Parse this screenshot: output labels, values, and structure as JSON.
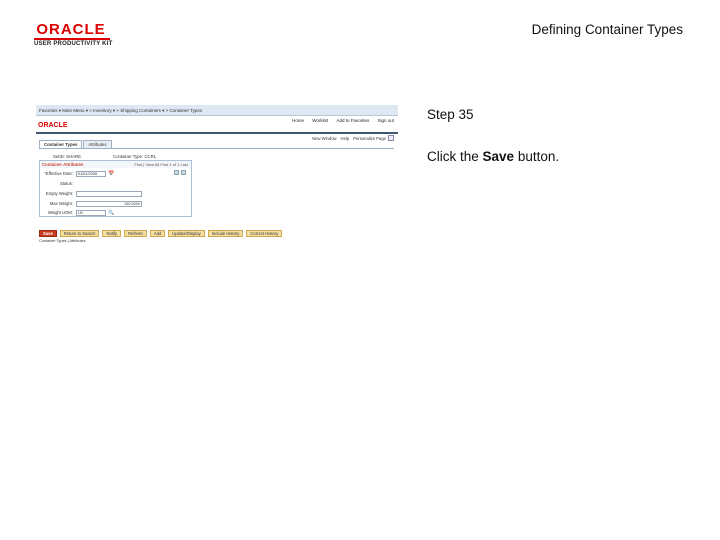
{
  "header": {
    "brand": "ORACLE",
    "product": "USER PRODUCTIVITY KIT",
    "slide_title": "Defining Container Types"
  },
  "step": {
    "label": "Step 35",
    "instruction_prefix": "Click the ",
    "instruction_target": "Save",
    "instruction_suffix": " button."
  },
  "app": {
    "breadcrumb": "Favorites ▾   Main Menu ▾  >  Inventory ▾  >  Shipping Containers ▾  >  Container Types",
    "top_nav": [
      "Home",
      "Worklist",
      "Add to Favorites",
      "Sign out"
    ],
    "logo": "ORACLE",
    "actions": [
      "New Window",
      "Help",
      "Personalize Page"
    ],
    "tabs": [
      {
        "label": "Container Types",
        "active": true
      },
      {
        "label": "Attributes",
        "active": false
      }
    ],
    "setid_label": "SetID: SHARE",
    "container_type_label": "Container Type: CCRL",
    "panel_title": "Container Attributes",
    "panel_nav": "Find | View All   First  1 of 1  Last",
    "fields": [
      {
        "label": "*Effective Date:",
        "value": "01/01/2008",
        "lookup": "📅"
      },
      {
        "label": "Status:",
        "value": "",
        "lookup": ""
      },
      {
        "label": "Empty Weight:",
        "value": "",
        "lookup": ""
      },
      {
        "label": "Max Weight:",
        "value": "150.0000",
        "lookup": ""
      },
      {
        "label": "Weight UOM:",
        "value": "LB",
        "lookup": "🔍"
      }
    ],
    "buttons": [
      {
        "label": "Save",
        "primary": true
      },
      {
        "label": "Return to Search",
        "primary": false
      },
      {
        "label": "Notify",
        "primary": false
      },
      {
        "label": "Refresh",
        "primary": false
      },
      {
        "label": "Add",
        "primary": false
      },
      {
        "label": "Update/Display",
        "primary": false
      },
      {
        "label": "Include History",
        "primary": false
      },
      {
        "label": "Correct History",
        "primary": false
      }
    ],
    "footer_link": "Container Types | Attributes"
  }
}
